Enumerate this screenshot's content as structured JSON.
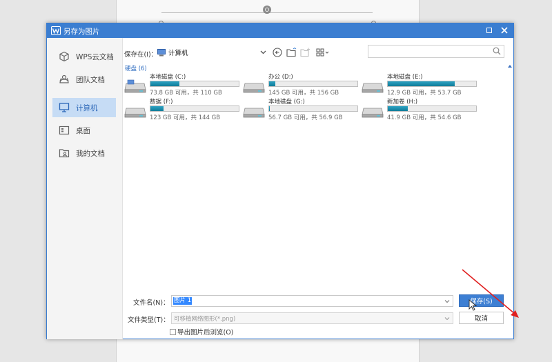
{
  "dialog": {
    "title": "另存为图片"
  },
  "sidebar": {
    "items": [
      {
        "label": "WPS云文档",
        "icon": "cube-icon",
        "active": false
      },
      {
        "label": "团队文档",
        "icon": "team-icon",
        "active": false
      },
      {
        "label": "计算机",
        "icon": "computer-icon",
        "active": true
      },
      {
        "label": "桌面",
        "icon": "desktop-icon",
        "active": false
      },
      {
        "label": "我的文档",
        "icon": "my-documents-icon",
        "active": false
      }
    ]
  },
  "toolbar": {
    "save_in_label": "保存在(I)：",
    "location": "计算机",
    "search_placeholder": ""
  },
  "file_area": {
    "group_header": "硬盘 (6)",
    "drives": [
      {
        "name": "本地磁盘 (C:)",
        "size": "73.8 GB 可用，共 110 GB",
        "used_fraction": 0.33,
        "icon": "system-drive-icon"
      },
      {
        "name": "办公 (D:)",
        "size": "145 GB 可用，共 156 GB",
        "used_fraction": 0.07,
        "icon": "hard-drive-icon"
      },
      {
        "name": "本地磁盘 (E:)",
        "size": "12.9 GB 可用，共 53.7 GB",
        "used_fraction": 0.76,
        "icon": "hard-drive-icon"
      },
      {
        "name": "数据 (F:)",
        "size": "123 GB 可用，共 144 GB",
        "used_fraction": 0.15,
        "icon": "hard-drive-icon"
      },
      {
        "name": "本地磁盘 (G:)",
        "size": "56.7 GB 可用，共 56.9 GB",
        "used_fraction": 0.004,
        "icon": "hard-drive-icon"
      },
      {
        "name": "新加卷 (H:)",
        "size": "41.9 GB 可用，共 54.6 GB",
        "used_fraction": 0.23,
        "icon": "hard-drive-icon"
      }
    ]
  },
  "bottom": {
    "filename_label": "文件名(N)：",
    "filename_value": "图片 1",
    "filetype_label": "文件类型(T)：",
    "filetype_value": "可移植网络图形(*.png)",
    "save_button": "保存(S)",
    "cancel_button": "取消",
    "checkbox_label": "导出图片后浏览(O)",
    "checkbox_checked": false
  },
  "colors": {
    "accent": "#3b7ed1",
    "drive_bar": "#1c8fb0",
    "annotation_arrow": "#e02020"
  }
}
